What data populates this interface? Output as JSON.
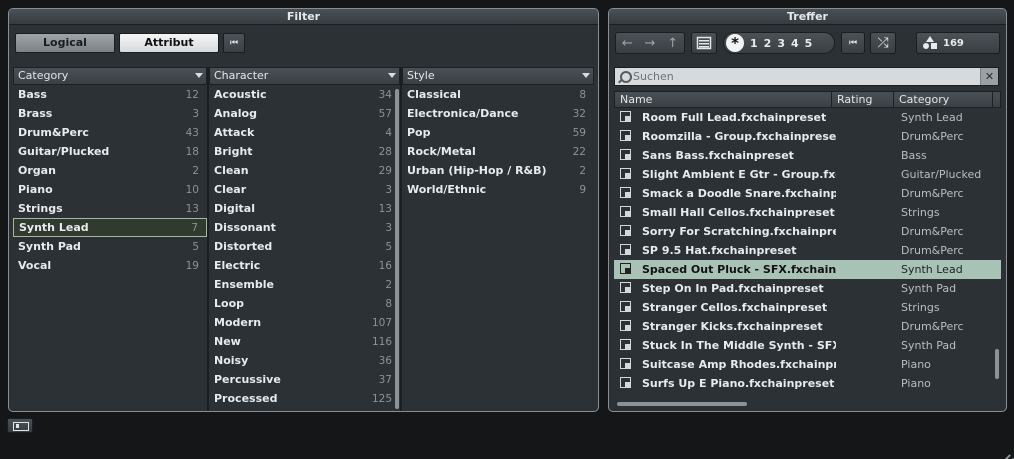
{
  "filter": {
    "title": "Filter",
    "logical_label": "Logical",
    "attribut_label": "Attribut",
    "reset_glyph": "⏮",
    "columns": [
      {
        "header": "Category",
        "items": [
          {
            "label": "Bass",
            "count": "12"
          },
          {
            "label": "Brass",
            "count": "3"
          },
          {
            "label": "Drum&Perc",
            "count": "43"
          },
          {
            "label": "Guitar/Plucked",
            "count": "18"
          },
          {
            "label": "Organ",
            "count": "2"
          },
          {
            "label": "Piano",
            "count": "10"
          },
          {
            "label": "Strings",
            "count": "13"
          },
          {
            "label": "Synth Lead",
            "count": "7",
            "selected": true
          },
          {
            "label": "Synth Pad",
            "count": "5"
          },
          {
            "label": "Vocal",
            "count": "19"
          }
        ]
      },
      {
        "header": "Character",
        "items": [
          {
            "label": "Acoustic",
            "count": "34"
          },
          {
            "label": "Analog",
            "count": "57"
          },
          {
            "label": "Attack",
            "count": "4"
          },
          {
            "label": "Bright",
            "count": "28"
          },
          {
            "label": "Clean",
            "count": "29"
          },
          {
            "label": "Clear",
            "count": "3"
          },
          {
            "label": "Digital",
            "count": "13"
          },
          {
            "label": "Dissonant",
            "count": "3"
          },
          {
            "label": "Distorted",
            "count": "5"
          },
          {
            "label": "Electric",
            "count": "16"
          },
          {
            "label": "Ensemble",
            "count": "2"
          },
          {
            "label": "Loop",
            "count": "8"
          },
          {
            "label": "Modern",
            "count": "107"
          },
          {
            "label": "New",
            "count": "116"
          },
          {
            "label": "Noisy",
            "count": "36"
          },
          {
            "label": "Percussive",
            "count": "37"
          },
          {
            "label": "Processed",
            "count": "125"
          }
        ]
      },
      {
        "header": "Style",
        "items": [
          {
            "label": "Classical",
            "count": "8"
          },
          {
            "label": "Electronica/Dance",
            "count": "32"
          },
          {
            "label": "Pop",
            "count": "59"
          },
          {
            "label": "Rock/Metal",
            "count": "22"
          },
          {
            "label": "Urban (Hip-Hop / R&B)",
            "count": "2"
          },
          {
            "label": "World/Ethnic",
            "count": "9"
          }
        ]
      }
    ]
  },
  "treffer": {
    "title": "Treffer",
    "nav": {
      "back": "←",
      "forward": "→",
      "up": "↑"
    },
    "rating": {
      "star": "*",
      "levels": [
        "1",
        "2",
        "3",
        "4",
        "5"
      ]
    },
    "reset_glyph": "⏮",
    "shuffle_glyph": "⤮",
    "result_count": "169",
    "search_placeholder": "Suchen",
    "search_clear": "✕",
    "columns": {
      "name": "Name",
      "rating": "Rating",
      "category": "Category"
    },
    "rows": [
      {
        "name": "Room Full Lead.fxchainpreset",
        "category": "Synth Lead"
      },
      {
        "name": "Roomzilla - Group.fxchainpreset",
        "category": "Drum&Perc"
      },
      {
        "name": "Sans Bass.fxchainpreset",
        "category": "Bass"
      },
      {
        "name": "Slight Ambient E Gtr - Group.fxchain",
        "category": "Guitar/Plucked"
      },
      {
        "name": "Smack a Doodle Snare.fxchainpreset",
        "category": "Drum&Perc"
      },
      {
        "name": "Small Hall Cellos.fxchainpreset",
        "category": "Strings"
      },
      {
        "name": "Sorry For Scratching.fxchainpreset",
        "category": "Drum&Perc"
      },
      {
        "name": "SP 9.5 Hat.fxchainpreset",
        "category": "Drum&Perc"
      },
      {
        "name": "Spaced Out Pluck - SFX.fxchainprese",
        "category": "Synth Lead",
        "selected": true
      },
      {
        "name": "Step On In Pad.fxchainpreset",
        "category": "Synth Pad"
      },
      {
        "name": "Stranger Cellos.fxchainpreset",
        "category": "Strings"
      },
      {
        "name": "Stranger Kicks.fxchainpreset",
        "category": "Drum&Perc"
      },
      {
        "name": "Stuck In The Middle Synth - SFX.fxch",
        "category": "Synth Pad"
      },
      {
        "name": "Suitcase Amp Rhodes.fxchainpreset",
        "category": "Piano"
      },
      {
        "name": "Surfs Up E Piano.fxchainpreset",
        "category": "Piano"
      }
    ]
  },
  "colors": {
    "panel_bg": "#2c3135",
    "selected_row": "#a9c2b6",
    "selected_filter_border": "#a5b89a"
  }
}
